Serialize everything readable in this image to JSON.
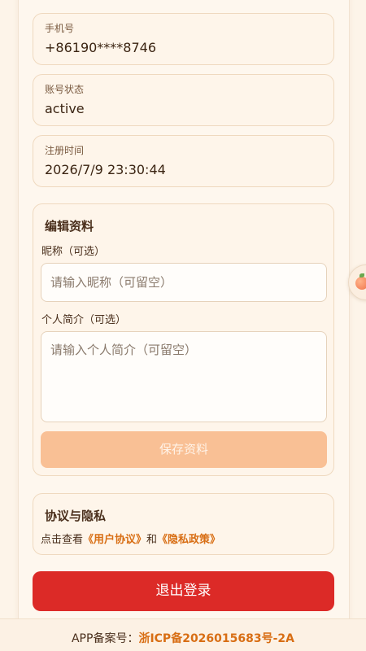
{
  "info": [
    {
      "label": "手机号",
      "value": "+86190****8746"
    },
    {
      "label": "账号状态",
      "value": "active"
    },
    {
      "label": "注册时间",
      "value": "2026/7/9 23:30:44"
    }
  ],
  "edit": {
    "title": "编辑资料",
    "nickname_label": "昵称（可选）",
    "nickname_placeholder": "请输入昵称（可留空）",
    "bio_label": "个人简介（可选）",
    "bio_placeholder": "请输入个人简介（可留空）",
    "save_label": "保存资料"
  },
  "privacy": {
    "title": "协议与隐私",
    "prefix": "点击查看",
    "user_agreement": "《用户协议》",
    "conjunction": "和",
    "privacy_policy": "《隐私政策》"
  },
  "logout_label": "退出登录",
  "footer": {
    "prefix": "APP备案号：",
    "icp": "浙ICP备2026015683号-2A"
  },
  "float_icon": "peach-icon",
  "colors": {
    "accent": "#d86e14",
    "logout": "#dc2a27",
    "save_disabled": "#f9c095",
    "background": "#fdf4e9"
  }
}
